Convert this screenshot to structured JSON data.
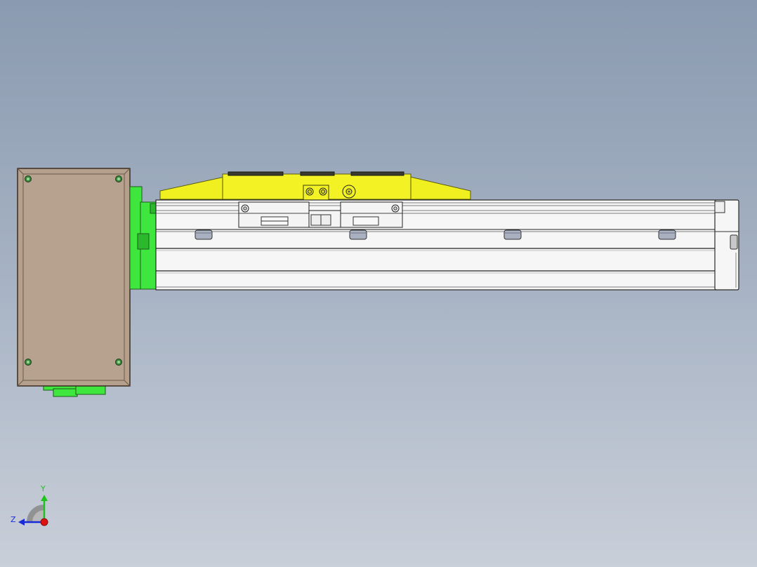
{
  "viewport": {
    "background_top": "#8a9ab0",
    "background_bottom": "#c9cfd9"
  },
  "colors": {
    "motor_body": "#b4a08c",
    "motor_edge": "#5e4a3a",
    "coupler_green": "#3ee63e",
    "carriage_yellow": "#f0f020",
    "rail_white": "#f4f4f4",
    "rail_edge": "#3a3a3a",
    "bolt_gray": "#a9b0c0"
  },
  "triad": {
    "y_label": "Y",
    "z_label": "Z",
    "y_color": "#1ec31e",
    "z_color": "#1a2ad8",
    "x_color": "#e01010"
  },
  "model": {
    "motor_icon": "stepper-motor-icon",
    "actuator_icon": "linear-actuator-icon"
  }
}
